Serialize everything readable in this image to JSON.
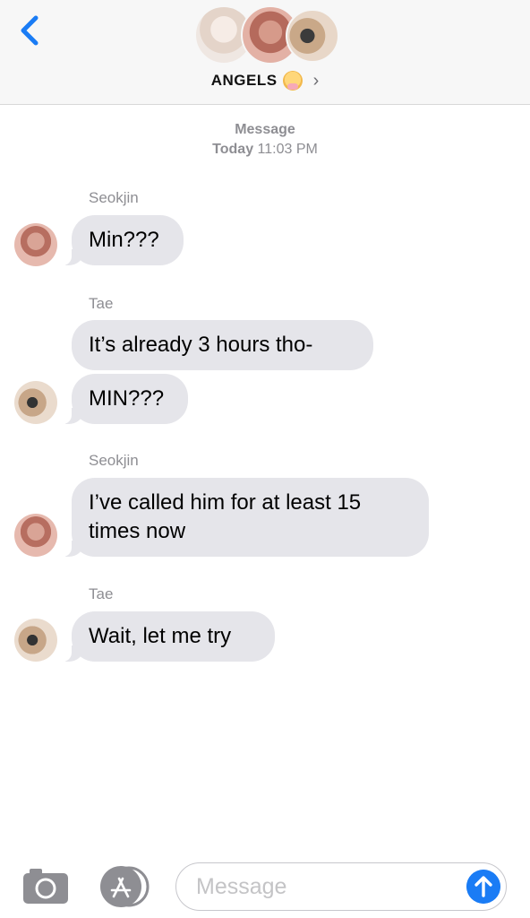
{
  "header": {
    "back_icon": "chevron-left-icon",
    "group_name": "ANGELS",
    "group_emoji": "baby-angel-emoji",
    "details_icon": "chevron-right-icon",
    "accent_color": "#1a7cf5"
  },
  "timestamp": {
    "title": "Message",
    "day": "Today",
    "time": "11:03 PM"
  },
  "messages": [
    {
      "sender": "Seokjin",
      "text": "Min???"
    },
    {
      "sender": "Tae",
      "text": "It’s already 3 hours tho-"
    },
    {
      "sender": "",
      "text": "MIN???"
    },
    {
      "sender": "Seokjin",
      "text": "I’ve called him for at least 15 times now"
    },
    {
      "sender": "Tae",
      "text": "Wait, let me try"
    }
  ],
  "composer": {
    "camera_icon": "camera-icon",
    "apps_icon": "app-store-icon",
    "placeholder": "Message",
    "send_icon": "arrow-up-icon"
  }
}
